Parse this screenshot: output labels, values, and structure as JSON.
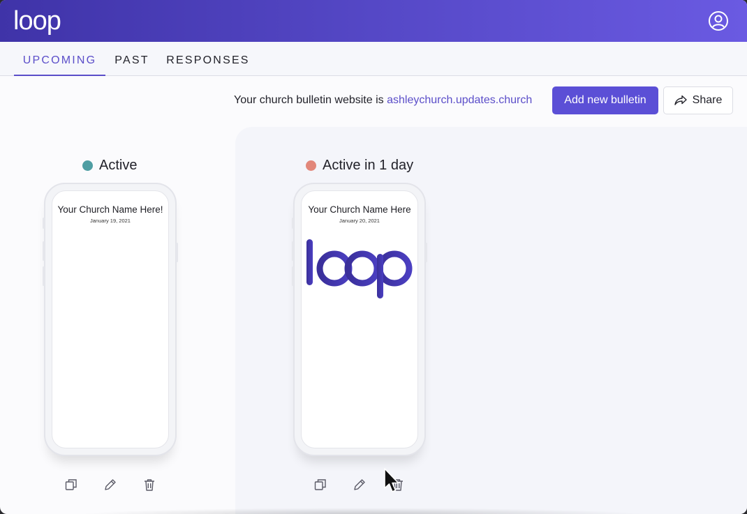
{
  "app": {
    "logo_text": "loop"
  },
  "tabs": [
    {
      "label": "UPCOMING",
      "active": true
    },
    {
      "label": "PAST",
      "active": false
    },
    {
      "label": "RESPONSES",
      "active": false
    }
  ],
  "site_info": {
    "prefix": "Your church bulletin website is ",
    "url_text": "ashleychurch.updates.church"
  },
  "toolbar": {
    "add_label": "Add new bulletin",
    "share_label": "Share"
  },
  "bulletins": [
    {
      "status": "Active",
      "status_color": "#4f9ea3",
      "church_name": "Your Church Name Here!",
      "date": "January 19, 2021"
    },
    {
      "status": "Active in 1 day",
      "status_color": "#e2877a",
      "church_name": "Your Church Name Here",
      "date": "January 20, 2021",
      "logo_text": "loop"
    }
  ],
  "colors": {
    "accent": "#5b4ec9",
    "header_start": "#3f33a8",
    "header_end": "#6a5ae2"
  },
  "icons": [
    "account-icon",
    "share-icon",
    "duplicate-icon",
    "edit-icon",
    "delete-icon",
    "mouse-pointer-icon"
  ]
}
